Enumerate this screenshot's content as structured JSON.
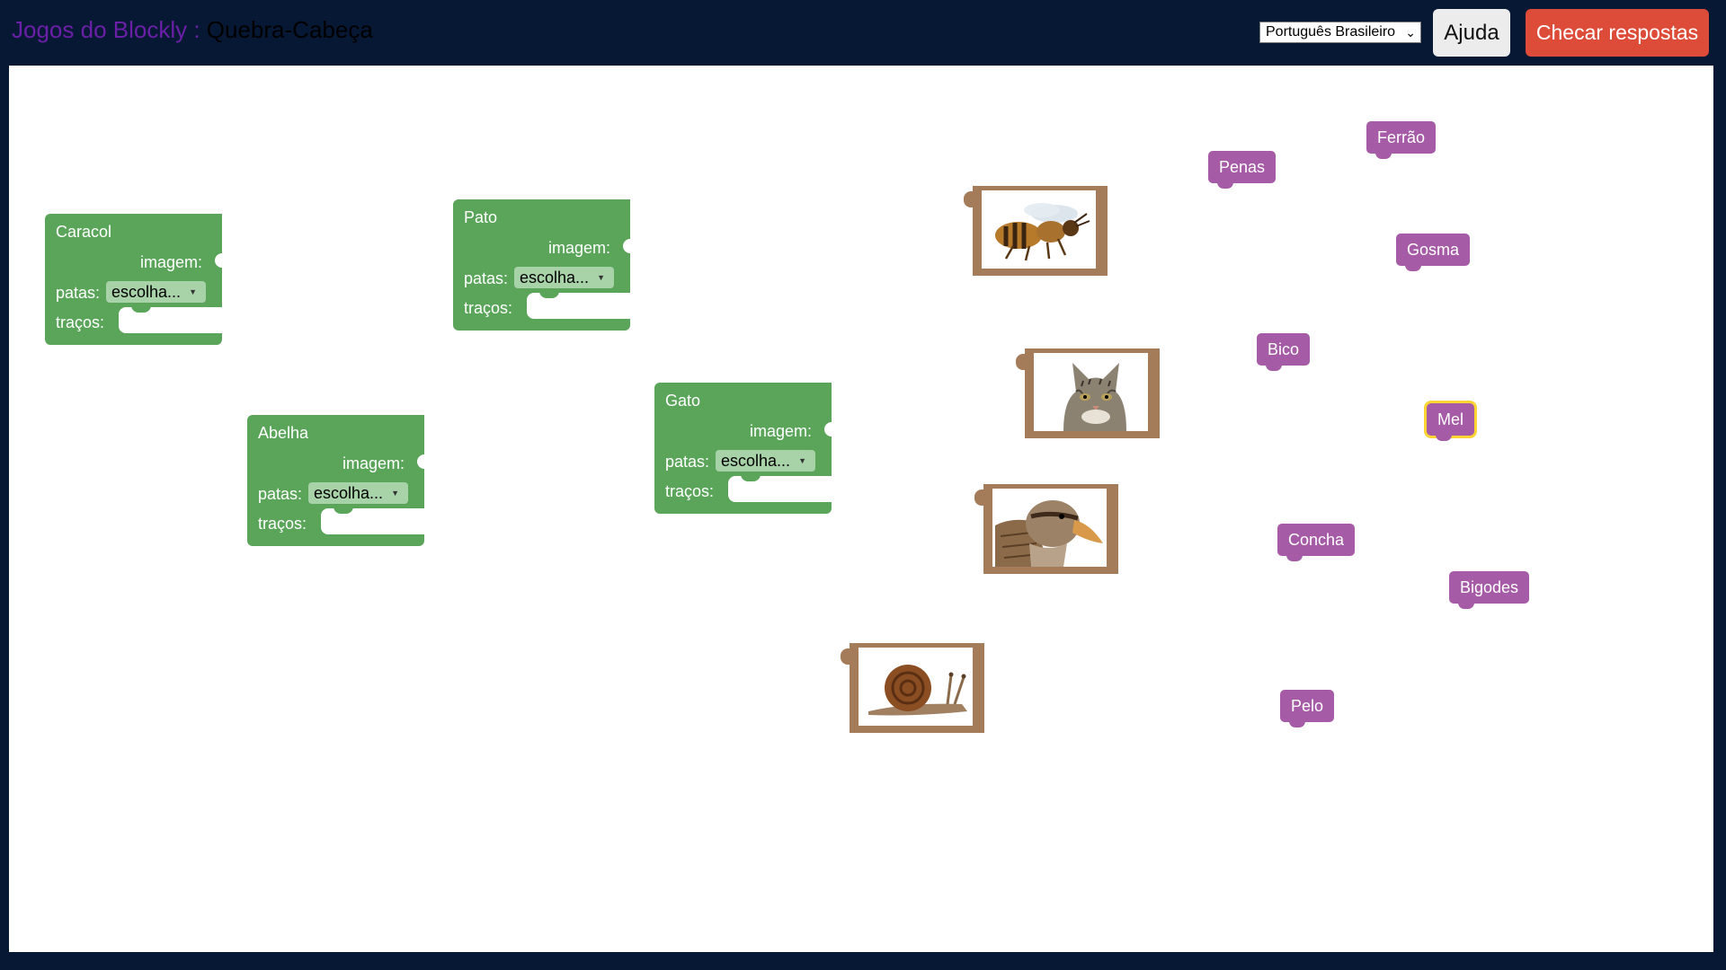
{
  "header": {
    "app_name": "Jogos do Blockly",
    "separator": " : ",
    "page_name": "Quebra-Cabeça",
    "language": "Português Brasileiro",
    "help_label": "Ajuda",
    "check_label": "Checar respostas"
  },
  "animal_blocks": [
    {
      "name": "Caracol",
      "image_label": "imagem:",
      "legs_label": "patas:",
      "legs_value": "escolha...",
      "traits_label": "traços:"
    },
    {
      "name": "Pato",
      "image_label": "imagem:",
      "legs_label": "patas:",
      "legs_value": "escolha...",
      "traits_label": "traços:"
    },
    {
      "name": "Abelha",
      "image_label": "imagem:",
      "legs_label": "patas:",
      "legs_value": "escolha...",
      "traits_label": "traços:"
    },
    {
      "name": "Gato",
      "image_label": "imagem:",
      "legs_label": "patas:",
      "legs_value": "escolha...",
      "traits_label": "traços:"
    }
  ],
  "image_blocks": [
    {
      "animal": "bee",
      "icon": "bee-photo"
    },
    {
      "animal": "cat",
      "icon": "cat-photo"
    },
    {
      "animal": "duck",
      "icon": "duck-photo"
    },
    {
      "animal": "snail",
      "icon": "snail-photo"
    }
  ],
  "trait_blocks": [
    {
      "label": "Ferrão"
    },
    {
      "label": "Penas"
    },
    {
      "label": "Gosma"
    },
    {
      "label": "Bico"
    },
    {
      "label": "Mel",
      "selected": true
    },
    {
      "label": "Concha"
    },
    {
      "label": "Bigodes"
    },
    {
      "label": "Pelo"
    }
  ],
  "colors": {
    "background": "#061834",
    "animal_block": "#5ba55b",
    "trait_block": "#a55ba5",
    "image_block": "#a47c5a",
    "check_button": "#dd4b39",
    "selection": "#fcd535"
  }
}
